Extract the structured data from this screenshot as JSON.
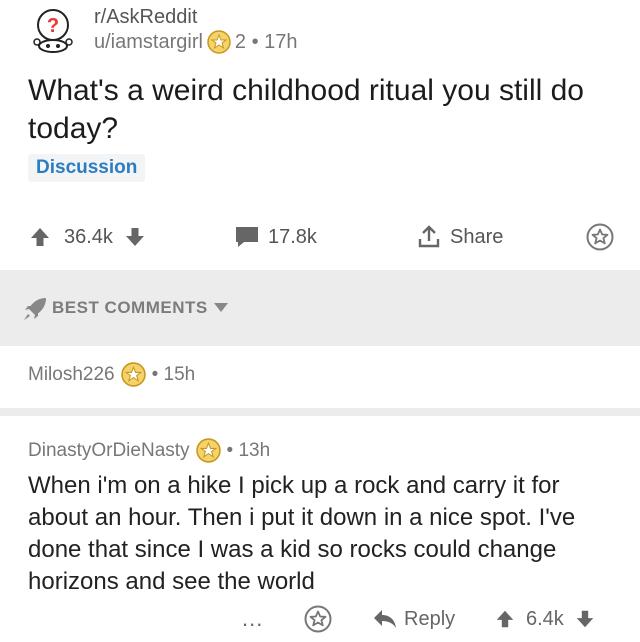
{
  "post": {
    "subreddit": "r/AskReddit",
    "author": "u/iamstargirl",
    "meta": "2 • 17h",
    "title": "What's a weird childhood ritual you still do today?",
    "flair": "Discussion",
    "upvotes": "36.4k",
    "comments": "17.8k",
    "share_label": "Share"
  },
  "sort": {
    "label": "BEST COMMENTS"
  },
  "comments": [
    {
      "author": "Milosh226",
      "time": "• 15h"
    },
    {
      "author": "DinastyOrDieNasty",
      "time": "• 13h",
      "body": "When i'm on a hike I pick up a rock and carry it for about an hour. Then i put it down in a nice spot. I've done that since I was a kid so rocks could change horizons and see the world",
      "more_label": "...",
      "reply_label": "Reply",
      "score": "6.4k"
    }
  ],
  "colors": {
    "flair": "#2d7cc1",
    "badge": "#e7b93b",
    "sort_bg": "#ececec"
  },
  "icons": [
    "reddit-alien-icon",
    "award-badge-icon",
    "upvote-icon",
    "downvote-icon",
    "comment-icon",
    "share-icon",
    "save-icon",
    "rocket-icon",
    "caret-down-icon",
    "reply-icon",
    "more-icon"
  ]
}
